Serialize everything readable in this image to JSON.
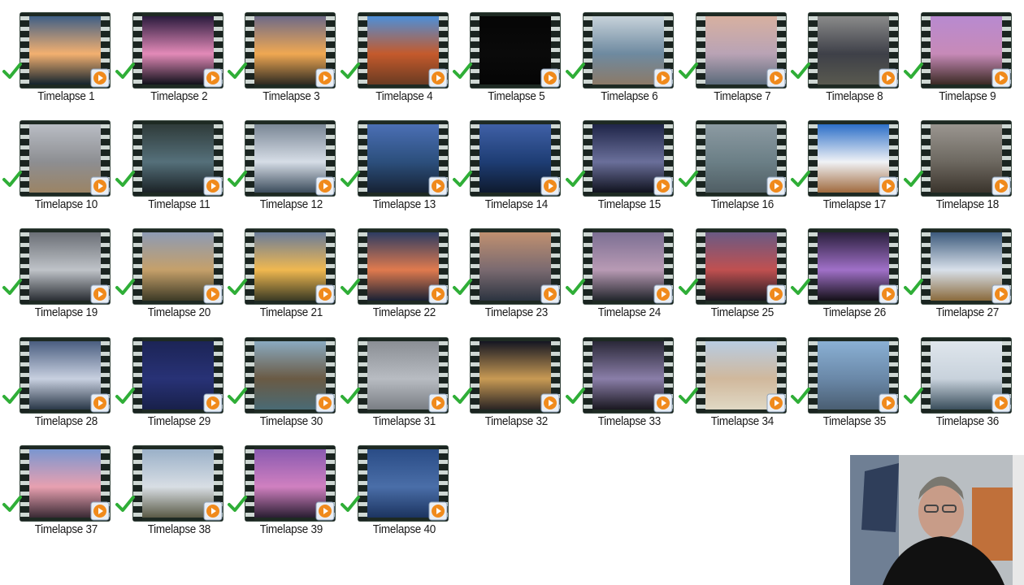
{
  "items": [
    {
      "label": "Timelapse 1",
      "colors": [
        "#3f5f86",
        "#f3b070",
        "#14242e"
      ]
    },
    {
      "label": "Timelapse 2",
      "colors": [
        "#2a1b3d",
        "#e38ab8",
        "#10101a"
      ]
    },
    {
      "label": "Timelapse 3",
      "colors": [
        "#6e6a88",
        "#f0a852",
        "#2e2a22"
      ]
    },
    {
      "label": "Timelapse 4",
      "colors": [
        "#4d8fd8",
        "#c45a2c",
        "#6a3b22"
      ]
    },
    {
      "label": "Timelapse 5",
      "colors": [
        "#050505",
        "#0a0a0a",
        "#050505"
      ]
    },
    {
      "label": "Timelapse 6",
      "colors": [
        "#c7d2da",
        "#6e8aa0",
        "#8c7a68"
      ]
    },
    {
      "label": "Timelapse 7",
      "colors": [
        "#d7b0a0",
        "#b9a3b5",
        "#5a6a7a"
      ]
    },
    {
      "label": "Timelapse 8",
      "colors": [
        "#8a8a8a",
        "#3e4048",
        "#59594f"
      ]
    },
    {
      "label": "Timelapse 9",
      "colors": [
        "#b88ad0",
        "#c78ab8",
        "#3b2a24"
      ]
    },
    {
      "label": "Timelapse 10",
      "colors": [
        "#b9bdc4",
        "#8d8e92",
        "#9b8465"
      ]
    },
    {
      "label": "Timelapse 11",
      "colors": [
        "#2f3b3a",
        "#55707a",
        "#1b2226"
      ]
    },
    {
      "label": "Timelapse 12",
      "colors": [
        "#7a8796",
        "#d6dde6",
        "#3c4c5c"
      ]
    },
    {
      "label": "Timelapse 13",
      "colors": [
        "#4b6fb5",
        "#2c4f7c",
        "#162234"
      ]
    },
    {
      "label": "Timelapse 14",
      "colors": [
        "#3f60a6",
        "#1e3d74",
        "#0e1a2e"
      ]
    },
    {
      "label": "Timelapse 15",
      "colors": [
        "#1f2548",
        "#6a6f9a",
        "#10121e"
      ]
    },
    {
      "label": "Timelapse 16",
      "colors": [
        "#8c9aa2",
        "#6b7f86",
        "#505e64"
      ]
    },
    {
      "label": "Timelapse 17",
      "colors": [
        "#2c6fc8",
        "#f0f2f6",
        "#a06a3e"
      ]
    },
    {
      "label": "Timelapse 18",
      "colors": [
        "#9a9690",
        "#6d6860",
        "#3a342c"
      ]
    },
    {
      "label": "Timelapse 19",
      "colors": [
        "#6b6f76",
        "#bfc3c8",
        "#2a2e34"
      ]
    },
    {
      "label": "Timelapse 20",
      "colors": [
        "#8d9bb4",
        "#c5a06a",
        "#3d3a26"
      ]
    },
    {
      "label": "Timelapse 21",
      "colors": [
        "#6a7c9a",
        "#f0b850",
        "#3a3a24"
      ]
    },
    {
      "label": "Timelapse 22",
      "colors": [
        "#2d3c62",
        "#e07a4e",
        "#1a2134"
      ]
    },
    {
      "label": "Timelapse 23",
      "colors": [
        "#c09070",
        "#7a6a70",
        "#2c3440"
      ]
    },
    {
      "label": "Timelapse 24",
      "colors": [
        "#7c6f93",
        "#b89ab4",
        "#22262c"
      ]
    },
    {
      "label": "Timelapse 25",
      "colors": [
        "#6a5a84",
        "#c05050",
        "#1a1820"
      ]
    },
    {
      "label": "Timelapse 26",
      "colors": [
        "#2a1f3c",
        "#a070c8",
        "#141018"
      ]
    },
    {
      "label": "Timelapse 27",
      "colors": [
        "#3c5a7c",
        "#d8e0ea",
        "#8a6a3c"
      ]
    },
    {
      "label": "Timelapse 28",
      "colors": [
        "#4a5e80",
        "#c8d0e0",
        "#2a3848"
      ]
    },
    {
      "label": "Timelapse 29",
      "colors": [
        "#1c2456",
        "#283276",
        "#18204a"
      ]
    },
    {
      "label": "Timelapse 30",
      "colors": [
        "#8aaac0",
        "#6a5a44",
        "#4a6a74"
      ]
    },
    {
      "label": "Timelapse 31",
      "colors": [
        "#8a8e94",
        "#b8bcc2",
        "#7a7e84"
      ]
    },
    {
      "label": "Timelapse 32",
      "colors": [
        "#141622",
        "#c89a54",
        "#2a2424"
      ]
    },
    {
      "label": "Timelapse 33",
      "colors": [
        "#2a2838",
        "#8a7ea8",
        "#1a1820"
      ]
    },
    {
      "label": "Timelapse 34",
      "colors": [
        "#b8cce2",
        "#d0b89c",
        "#e0d8c4"
      ]
    },
    {
      "label": "Timelapse 35",
      "colors": [
        "#8ab0d4",
        "#6a88a8",
        "#4a5e72"
      ]
    },
    {
      "label": "Timelapse 36",
      "colors": [
        "#dfe6ec",
        "#c8d2dc",
        "#3a4e5c"
      ]
    },
    {
      "label": "Timelapse 37",
      "colors": [
        "#7a96d0",
        "#e8a0b0",
        "#3a2a34"
      ]
    },
    {
      "label": "Timelapse 38",
      "colors": [
        "#9ab0c8",
        "#d8dee4",
        "#5a5a46"
      ]
    },
    {
      "label": "Timelapse 39",
      "colors": [
        "#8a5ab0",
        "#d080c0",
        "#2a1e32"
      ]
    },
    {
      "label": "Timelapse 40",
      "colors": [
        "#2a4c86",
        "#4a6ea8",
        "#1c3460"
      ]
    }
  ],
  "check_color": "#2fae37",
  "play_color": "#f08a1c"
}
